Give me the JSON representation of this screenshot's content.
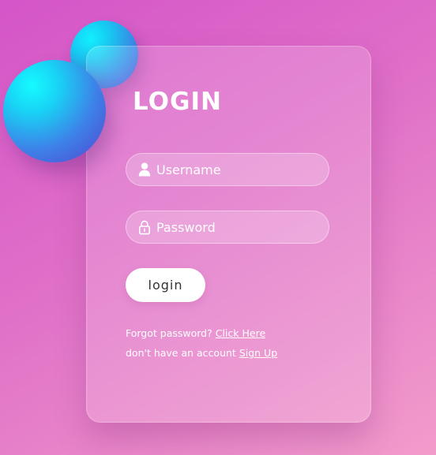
{
  "login_card": {
    "title": "LOGIN",
    "username": {
      "placeholder": "Username",
      "value": "",
      "icon": "user-icon"
    },
    "password": {
      "placeholder": "Password",
      "value": "",
      "icon": "lock-icon"
    },
    "login_button_label": "login",
    "forgot_password_text": "Forgot password?",
    "forgot_password_link": "Click Here",
    "signup_text": "don't have an account",
    "signup_link": "Sign Up"
  },
  "colors": {
    "background_start": "#d455c8",
    "background_end": "#f29ccb",
    "sphere_cyan": "#15fbff",
    "sphere_blue": "#5243d0",
    "button_background": "#ffffff",
    "text": "#ffffff"
  }
}
